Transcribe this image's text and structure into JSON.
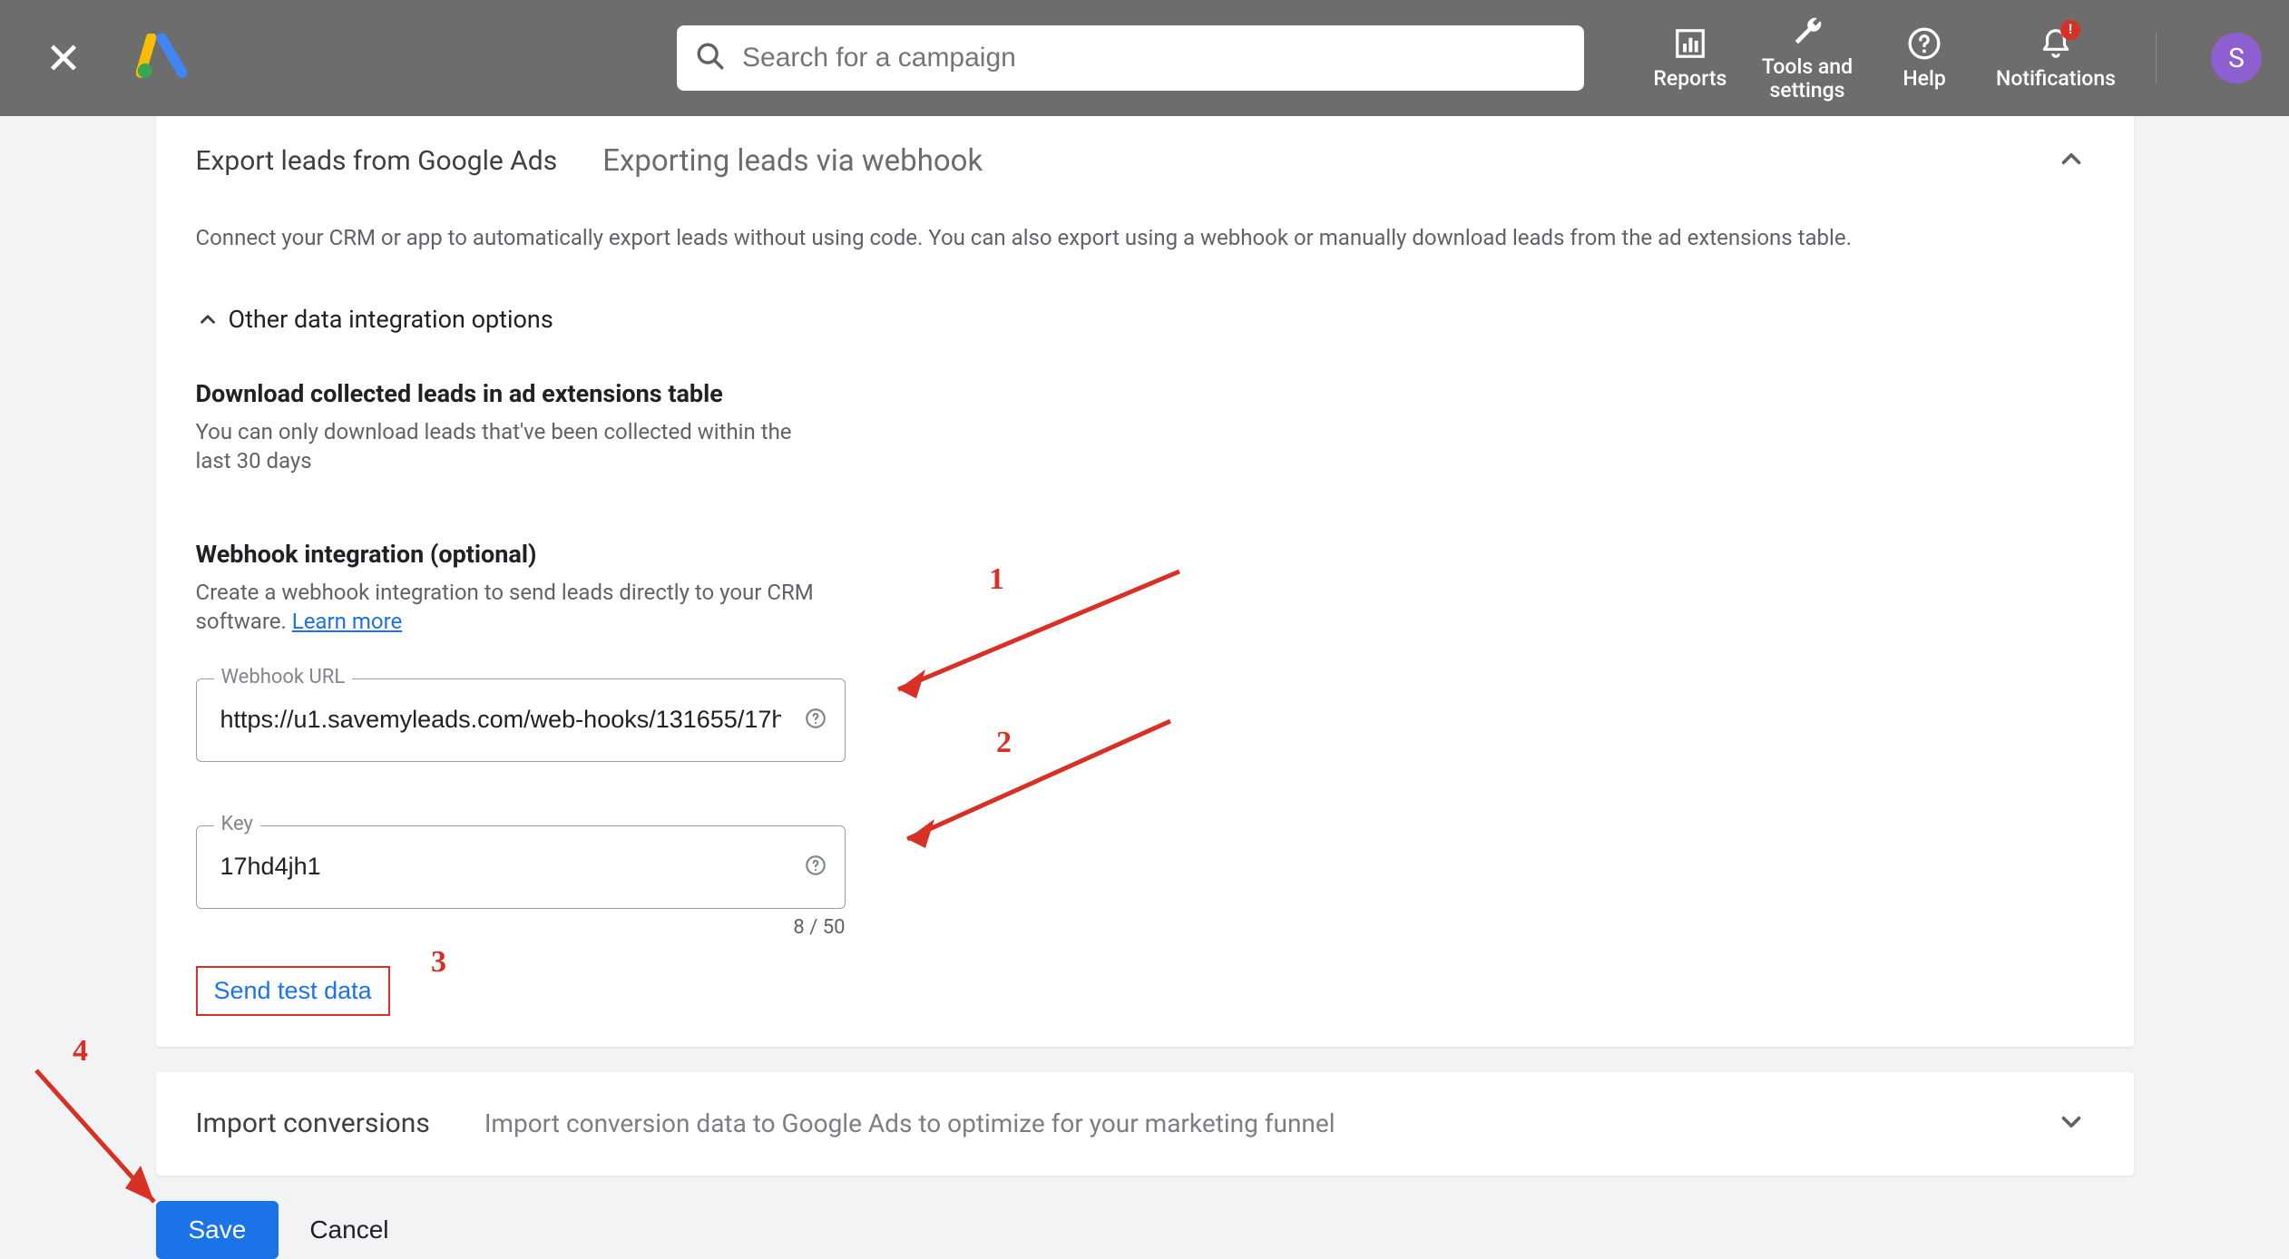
{
  "header": {
    "search_placeholder": "Search for a campaign",
    "nav": {
      "reports": "Reports",
      "tools": "Tools and\nsettings",
      "help": "Help",
      "notifications": "Notifications",
      "notif_badge": "!"
    },
    "avatar_letter": "S"
  },
  "main": {
    "title_left": "Export leads from Google Ads",
    "title_right": "Exporting leads via webhook",
    "description": "Connect your CRM or app to automatically export leads without using code. You can also export using a webhook or manually download leads from the ad extensions table.",
    "other_toggle": "Other data integration options",
    "download": {
      "heading": "Download collected leads in ad extensions table",
      "body": "You can only download leads that've been collected within the last 30 days"
    },
    "webhook": {
      "heading": "Webhook integration (optional)",
      "body_prefix": "Create a webhook integration to send leads directly to your CRM software. ",
      "learn_more": "Learn more",
      "url_label": "Webhook URL",
      "url_value": "https://u1.savemyleads.com/web-hooks/131655/17h",
      "key_label": "Key",
      "key_value": "17hd4jh1",
      "key_count": "8 / 50",
      "send_test": "Send test data"
    }
  },
  "import": {
    "title": "Import conversions",
    "subtitle": "Import conversion data to Google Ads to optimize for your marketing funnel"
  },
  "actions": {
    "save": "Save",
    "cancel": "Cancel"
  },
  "annotations": {
    "n1": "1",
    "n2": "2",
    "n3": "3",
    "n4": "4"
  }
}
